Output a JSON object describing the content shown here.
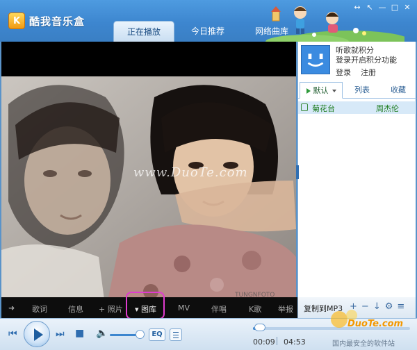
{
  "app": {
    "title": "酷我音乐盒",
    "logo_glyph": "K"
  },
  "tabs": [
    {
      "label": "正在播放",
      "active": true
    },
    {
      "label": "今日推荐",
      "active": false
    },
    {
      "label": "网络曲库",
      "active": false
    }
  ],
  "window_controls": [
    "↔",
    "↖",
    "—",
    "□",
    "✕"
  ],
  "video": {
    "watermark": "www.DuoTe.com",
    "small_watermark": "TUNGNFOTO"
  },
  "video_tabs": [
    {
      "label": "歌词"
    },
    {
      "label": "信息"
    },
    {
      "label": "+ 照片"
    },
    {
      "label": "▾ 图库"
    },
    {
      "label": "MV"
    },
    {
      "label": "伴唱"
    },
    {
      "label": "K歌"
    },
    {
      "label": "举报"
    }
  ],
  "user_panel": {
    "line1": "听歌就积分",
    "line2": "登录开启积分功能",
    "login": "登录",
    "register": "注册"
  },
  "playlist_tabs": {
    "default": "默认",
    "list": "列表",
    "favorites": "收藏"
  },
  "playlist": [
    {
      "title": "菊花台",
      "artist": "周杰伦"
    }
  ],
  "right_toolbar": {
    "copy_to_mp3": "复制到MP3",
    "icons": [
      "+",
      "−",
      "↓",
      "⚙",
      "≡"
    ]
  },
  "controls": {
    "eq_label": "EQ",
    "time_current": "00:09",
    "time_total": "04:53",
    "progress_fraction": 0.032,
    "volume_fraction": 0.85
  },
  "site_watermark": {
    "name": "DuoTe.com",
    "slogan": "国内最安全的软件站"
  }
}
